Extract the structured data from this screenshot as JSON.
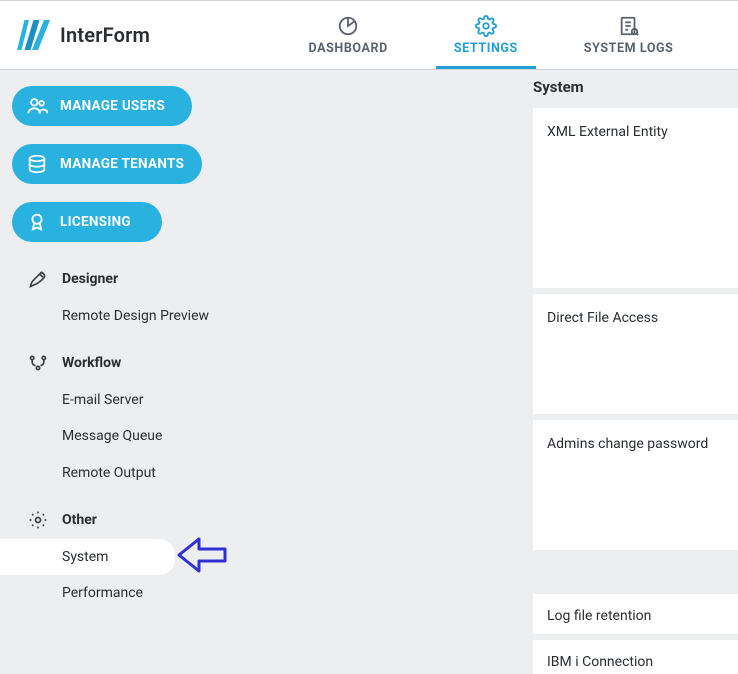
{
  "header": {
    "app_title": "InterForm",
    "tabs": {
      "dashboard": "DASHBOARD",
      "settings": "SETTINGS",
      "system_logs": "SYSTEM LOGS"
    }
  },
  "sidebar": {
    "buttons": {
      "manage_users": "MANAGE USERS",
      "manage_tenants": "MANAGE TENANTS",
      "licensing": "LICENSING"
    },
    "sections": {
      "designer": {
        "title": "Designer",
        "items": {
          "remote_preview": "Remote Design Preview"
        }
      },
      "workflow": {
        "title": "Workflow",
        "items": {
          "email": "E-mail Server",
          "mq": "Message Queue",
          "remote_output": "Remote Output"
        }
      },
      "other": {
        "title": "Other",
        "items": {
          "system": "System",
          "performance": "Performance"
        }
      }
    }
  },
  "panel": {
    "title": "System",
    "cards": {
      "xml": "XML External Entity",
      "dfa": "Direct File Access",
      "admin_pw": "Admins change password",
      "log_retention": "Log file retention",
      "ibm": "IBM i Connection"
    }
  }
}
